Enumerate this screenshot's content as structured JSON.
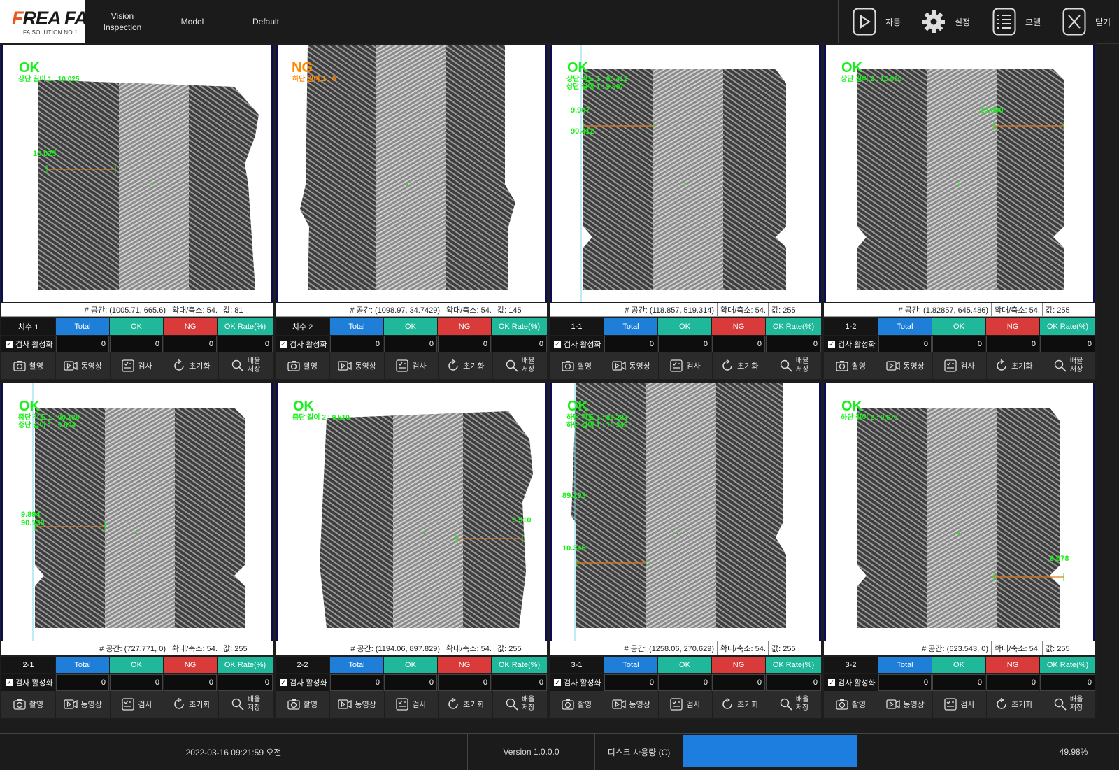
{
  "app": {
    "logo_main": "FREA FA",
    "logo_sub": "FA SOLUTION NO.1",
    "nav": [
      "Vision\nInspection",
      "Model",
      "Default"
    ],
    "toolbar": [
      {
        "label": "자동",
        "icon": "play-icon"
      },
      {
        "label": "설정",
        "icon": "gear-icon"
      },
      {
        "label": "모델",
        "icon": "list-icon"
      },
      {
        "label": "닫기",
        "icon": "close-icon"
      }
    ]
  },
  "headers": {
    "total": "Total",
    "ok": "OK",
    "ng": "NG",
    "rate": "OK Rate(%)",
    "enable": "검사 활성화"
  },
  "buttons": {
    "capture": "촬영",
    "video": "동영상",
    "inspect": "검사",
    "reset": "초기화",
    "save": "배율\n저장"
  },
  "panels": [
    {
      "name": "치수 1",
      "result": "OK",
      "meas": [
        "상단 길이 1 : 10.025"
      ],
      "dims": [
        "10.025"
      ],
      "coord": "# 공간: (1005.71, 665.6)",
      "zoom": "확대/축소: 54.",
      "value": "값: 81",
      "total": "0",
      "ok": "0",
      "ng": "0",
      "rate": "0"
    },
    {
      "name": "치수 2",
      "result": "NG",
      "meas": [
        "하단 길이 1 : 0"
      ],
      "dims": [],
      "coord": "# 공간: (1098.97, 34.7429)",
      "zoom": "확대/축소: 54.",
      "value": "값: 145",
      "total": "0",
      "ok": "0",
      "ng": "0",
      "rate": "0"
    },
    {
      "name": "1-1",
      "result": "OK",
      "meas": [
        "상단 각도 1 : 90.412",
        "상단 길이 1 : 9.907"
      ],
      "dims": [
        "9.907",
        "90.412"
      ],
      "coord": "# 공간: (118.857, 519.314)",
      "zoom": "확대/축소: 54.",
      "value": "값: 255",
      "total": "0",
      "ok": "0",
      "ng": "0",
      "rate": "0"
    },
    {
      "name": "1-2",
      "result": "OK",
      "meas": [
        "상단 길이 2 : 10.000"
      ],
      "dims": [
        "10.000"
      ],
      "coord": "# 공간: (1.82857, 645.486)",
      "zoom": "확대/축소: 54.",
      "value": "값: 255",
      "total": "0",
      "ok": "0",
      "ng": "0",
      "rate": "0"
    },
    {
      "name": "2-1",
      "result": "OK",
      "meas": [
        "중단 각도 1 : 90.138",
        "중단 길이 1 : 9.894"
      ],
      "dims": [
        "9.894",
        "90.138"
      ],
      "coord": "# 공간: (727.771, 0)",
      "zoom": "확대/축소: 54.",
      "value": "값: 255",
      "total": "0",
      "ok": "0",
      "ng": "0",
      "rate": "0"
    },
    {
      "name": "2-2",
      "result": "OK",
      "meas": [
        "중단 길이 2 : 9.510"
      ],
      "dims": [
        "9.510"
      ],
      "coord": "# 공간: (1194.06, 897.829)",
      "zoom": "확대/축소: 54.",
      "value": "값: 255",
      "total": "0",
      "ok": "0",
      "ng": "0",
      "rate": "0"
    },
    {
      "name": "3-1",
      "result": "OK",
      "meas": [
        "하단 각도 1 : 89.203",
        "하단 길이 1 : 10.345"
      ],
      "dims": [
        "89.203",
        "10.345"
      ],
      "coord": "# 공간: (1258.06, 270.629)",
      "zoom": "확대/축소: 54.",
      "value": "값: 255",
      "total": "0",
      "ok": "0",
      "ng": "0",
      "rate": "0"
    },
    {
      "name": "3-2",
      "result": "OK",
      "meas": [
        "하단 길이 2 : 9.678"
      ],
      "dims": [
        "9.678"
      ],
      "coord": "# 공간: (623.543, 0)",
      "zoom": "확대/축소: 54.",
      "value": "값: 255",
      "total": "0",
      "ok": "0",
      "ng": "0",
      "rate": "0"
    }
  ],
  "footer": {
    "datetime": "2022-03-16 09:21:59 오전",
    "version": "Version 1.0.0.0",
    "disk_label": "디스크 사용량 (C)",
    "disk_percent": "49.98%",
    "disk_fraction": 0.4998
  }
}
